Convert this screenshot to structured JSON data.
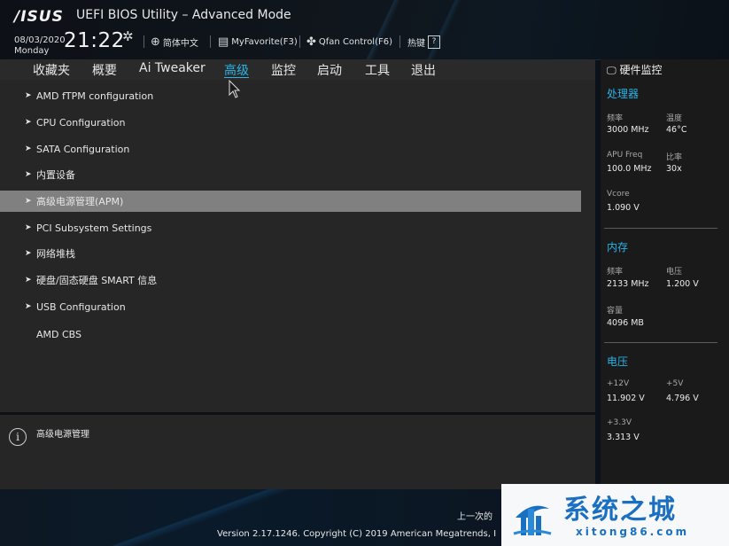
{
  "header": {
    "logo": "/ISUS",
    "title": "UEFI BIOS Utility – Advanced Mode",
    "date": "08/03/2020",
    "weekday": "Monday",
    "time": "21:22",
    "language": "简体中文",
    "myfavorite": "MyFavorite(F3)",
    "qfan": "Qfan Control(F6)",
    "hotkeys": "热键",
    "help_glyph": "?"
  },
  "menu": {
    "tabs": [
      {
        "label": "收藏夹"
      },
      {
        "label": "概要"
      },
      {
        "label": "Ai Tweaker"
      },
      {
        "label": "高级"
      },
      {
        "label": "监控"
      },
      {
        "label": "启动"
      },
      {
        "label": "工具"
      },
      {
        "label": "退出"
      }
    ],
    "active_tab": "高级"
  },
  "items": [
    {
      "label": "AMD fTPM configuration"
    },
    {
      "label": "CPU Configuration"
    },
    {
      "label": "SATA Configuration"
    },
    {
      "label": "内置设备"
    },
    {
      "label": "高级电源管理(APM)"
    },
    {
      "label": "PCI Subsystem Settings"
    },
    {
      "label": "网络堆栈"
    },
    {
      "label": "硬盘/固态硬盘 SMART 信息"
    },
    {
      "label": "USB Configuration"
    },
    {
      "label": "AMD CBS"
    }
  ],
  "selected_item": "高级电源管理(APM)",
  "info": {
    "icon": "i",
    "text": "高级电源管理"
  },
  "hw_monitor": {
    "title": "硬件监控",
    "cpu": {
      "title": "处理器",
      "freq_label": "频率",
      "freq": "3000 MHz",
      "temp_label": "温度",
      "temp": "46°C",
      "apu_label": "APU Freq",
      "apu": "100.0 MHz",
      "ratio_label": "比率",
      "ratio": "30x",
      "vcore_label": "Vcore",
      "vcore": "1.090 V"
    },
    "memory": {
      "title": "内存",
      "freq_label": "频率",
      "freq": "2133 MHz",
      "volt_label": "电压",
      "volt": "1.200 V",
      "cap_label": "容量",
      "cap": "4096 MB"
    },
    "voltage": {
      "title": "电压",
      "v12_label": "+12V",
      "v12": "11.902 V",
      "v5_label": "+5V",
      "v5": "4.796 V",
      "v33_label": "+3.3V",
      "v33": "3.313 V"
    }
  },
  "footer": {
    "last_modified": "上一次的",
    "version": "Version 2.17.1246. Copyright (C) 2019 American Megatrends, I"
  },
  "watermark": {
    "title": "系统之城",
    "url": "xitong86.com"
  },
  "colors": {
    "accent": "#28b6e6",
    "selected_row": "#808080",
    "panel": "#262626"
  }
}
